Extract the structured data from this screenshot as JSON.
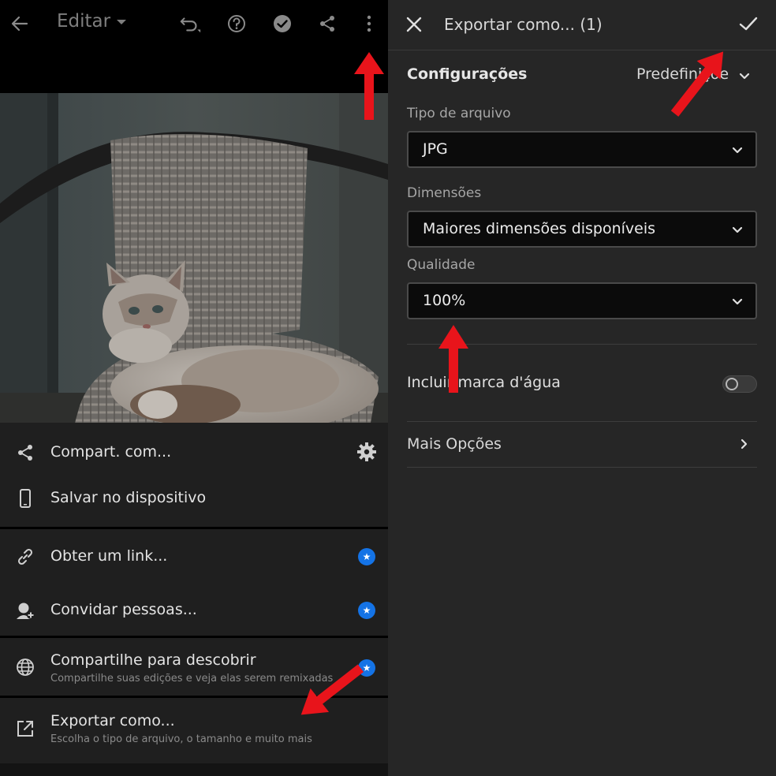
{
  "left_panel": {
    "topbar": {
      "title": "Editar",
      "icons": [
        "back-arrow-icon",
        "undo-icon",
        "help-icon",
        "check-circle-icon",
        "share-icon",
        "more-vertical-icon"
      ]
    },
    "photo": {
      "description_icon": "cat-on-wicker-chair-photo"
    },
    "menu": {
      "items": [
        {
          "label": "Compart. com...",
          "icon": "share-icon",
          "trailing_icon": "gear-icon"
        },
        {
          "label": "Salvar no dispositivo",
          "icon": "phone-icon"
        },
        {
          "label": "Obter um link...",
          "icon": "link-icon",
          "badge": "star-badge"
        },
        {
          "label": "Convidar pessoas...",
          "icon": "add-person-icon",
          "badge": "star-badge"
        },
        {
          "label": "Compartilhe para descobrir",
          "sublabel": "Compartilhe suas edições e veja elas serem remixadas",
          "icon": "globe-icon",
          "badge": "star-badge"
        },
        {
          "label": "Exportar como...",
          "sublabel": "Escolha o tipo de arquivo, o tamanho e muito mais",
          "icon": "export-icon"
        }
      ]
    }
  },
  "right_panel": {
    "header": {
      "title": "Exportar como... (1)",
      "close_icon": "close-icon",
      "confirm_icon": "checkmark-icon"
    },
    "settings": {
      "title": "Configurações",
      "presets_label": "Predefinições"
    },
    "file_type": {
      "label": "Tipo de arquivo",
      "value": "JPG"
    },
    "dimensions": {
      "label": "Dimensões",
      "value": "Maiores dimensões disponíveis"
    },
    "quality": {
      "label": "Qualidade",
      "value": "100%"
    },
    "watermark": {
      "label": "Incluir marca d'água",
      "enabled": false
    },
    "more_options": {
      "label": "Mais Opções"
    }
  },
  "colors": {
    "background_dark": "#000000",
    "menu_bg": "#1f1f1f",
    "panel_bg": "#262626",
    "accent_blue": "#1473e6",
    "annotation_red": "#e8141b"
  }
}
